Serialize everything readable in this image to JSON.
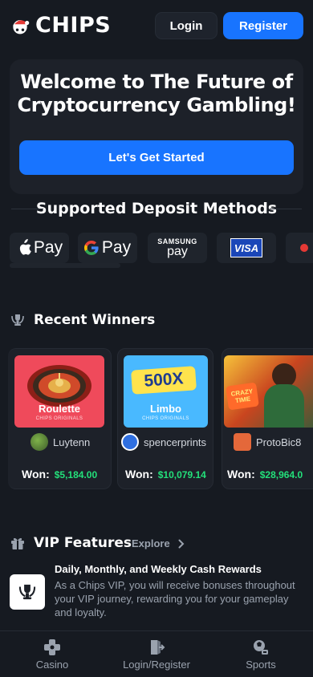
{
  "header": {
    "logo_text": "CHIPS",
    "login_label": "Login",
    "register_label": "Register"
  },
  "hero": {
    "title_line1": "Welcome to The Future of",
    "title_line2": "Cryptocurrency Gambling!",
    "cta_label": "Let's Get Started"
  },
  "deposit": {
    "heading": "Supported Deposit Methods",
    "methods": [
      {
        "name": "Apple Pay",
        "icon": "apple-pay-icon",
        "text": "Pay"
      },
      {
        "name": "Google Pay",
        "icon": "google-pay-icon",
        "text": "Pay"
      },
      {
        "name": "Samsung Pay",
        "icon": "samsung-pay-icon",
        "text_top": "SAMSUNG",
        "text_bottom": "pay"
      },
      {
        "name": "Visa",
        "icon": "visa-icon",
        "text": "VISA"
      }
    ]
  },
  "winners": {
    "heading": "Recent Winners",
    "won_label": "Won:",
    "items": [
      {
        "game": "Roulette",
        "subtitle": "CHIPS ORIGINALS",
        "user": "Luytenn",
        "amount": "$5,184.00"
      },
      {
        "game": "Limbo",
        "badge": "500X",
        "subtitle": "CHIPS ORIGINALS",
        "user": "spencerprints",
        "amount": "$10,079.14"
      },
      {
        "game": "CRAZY TIME",
        "user": "ProtoBic8",
        "amount": "$28,964.0"
      }
    ]
  },
  "vip": {
    "heading": "VIP Features",
    "explore_label": "Explore",
    "item_title": "Daily, Monthly, and Weekly Cash Rewards",
    "item_desc": "As a Chips VIP, you will receive bonuses throughout your VIP journey, rewarding you for your gameplay and loyalty."
  },
  "nav": {
    "items": [
      {
        "label": "Casino",
        "icon": "casino-icon"
      },
      {
        "label": "Login/Register",
        "icon": "login-icon"
      },
      {
        "label": "Sports",
        "icon": "sports-icon"
      }
    ]
  },
  "colors": {
    "background": "#161a21",
    "card": "#1d2129",
    "accent": "#1874ff",
    "win_green": "#23e07a"
  }
}
